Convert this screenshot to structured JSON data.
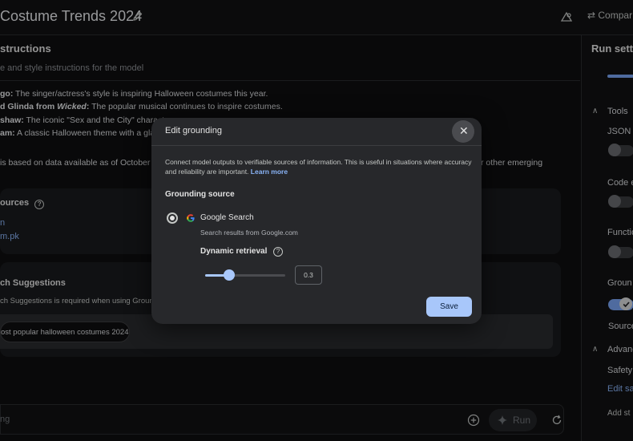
{
  "header": {
    "title": "Costume Trends 2024",
    "compare_label": "Compar"
  },
  "system_instructions": {
    "title": "structions",
    "subtitle": "e and style instructions for the model"
  },
  "content_lines": [
    {
      "bold": "go:",
      "text": " The singer/actress's style is inspiring Halloween costumes this year."
    },
    {
      "bold": "d Glinda from ",
      "italic": "Wicked",
      "bold2": ":",
      "text": " The popular musical continues to inspire costumes."
    },
    {
      "bold": "shaw:",
      "text": " The iconic \"Sex and the City\" characte"
    },
    {
      "bold": "am:",
      "text": " A classic Halloween theme with a glam"
    },
    {
      "text": " is based on data available as of October"
    },
    {
      "text": "r other emerging"
    }
  ],
  "sources_card": {
    "title": "ources",
    "links": [
      "n",
      "m.pk"
    ]
  },
  "search_card": {
    "title": "ch Suggestions",
    "note": "ch Suggestions is required when using Grounding",
    "chip": "ost popular halloween costumes 2024"
  },
  "input": {
    "placeholder": "ng",
    "run_label": "Run"
  },
  "right_panel": {
    "title": "Run settin",
    "tools_label": "Tools",
    "json_label": "JSON r",
    "code_label": "Code e",
    "function_label": "Functio",
    "grounding_label": "Groun",
    "source_label": "Source",
    "advanced_label": "Advanc",
    "safety_label": "Safety",
    "edit_safety_link": "Edit sa",
    "add_stop_label": "Add st"
  },
  "modal": {
    "title": "Edit grounding",
    "close_glyph": "✕",
    "description": "Connect model outputs to verifiable sources of information. This is useful in situations where accuracy and reliability are important.",
    "learn_more": "Learn more",
    "section_title": "Grounding source",
    "option_name": "Google Search",
    "option_desc": "Search results from Google.com",
    "dynamic_label": "Dynamic retrieval",
    "slider_value": "0.3",
    "slider_fraction": 0.3,
    "save_label": "Save",
    "help_glyph": "?"
  },
  "colors": {
    "accent": "#a8c7fa",
    "link": "#8ab4f8",
    "panel": "#27282b",
    "background": "#0f0f10"
  },
  "icons": {
    "pencil": "pencil-icon",
    "close": "close-icon",
    "google": "google-g-icon",
    "help": "help-icon",
    "sparkle": "sparkle-icon",
    "refresh": "refresh-icon",
    "add": "add-circle-icon",
    "compare": "compare-icon",
    "tune": "tune-icon"
  }
}
